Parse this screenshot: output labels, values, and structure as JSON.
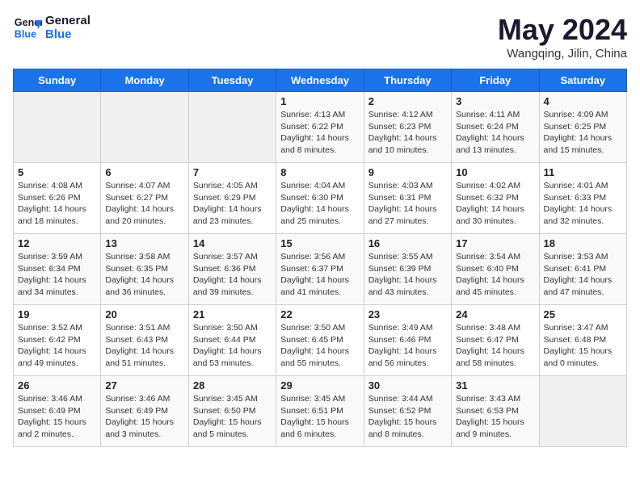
{
  "header": {
    "logo_line1": "General",
    "logo_line2": "Blue",
    "month_title": "May 2024",
    "location": "Wangqing, Jilin, China"
  },
  "days_of_week": [
    "Sunday",
    "Monday",
    "Tuesday",
    "Wednesday",
    "Thursday",
    "Friday",
    "Saturday"
  ],
  "weeks": [
    [
      {
        "day": "",
        "empty": true
      },
      {
        "day": "",
        "empty": true
      },
      {
        "day": "",
        "empty": true
      },
      {
        "day": "1",
        "sunrise": "4:13 AM",
        "sunset": "6:22 PM",
        "daylight": "14 hours and 8 minutes."
      },
      {
        "day": "2",
        "sunrise": "4:12 AM",
        "sunset": "6:23 PM",
        "daylight": "14 hours and 10 minutes."
      },
      {
        "day": "3",
        "sunrise": "4:11 AM",
        "sunset": "6:24 PM",
        "daylight": "14 hours and 13 minutes."
      },
      {
        "day": "4",
        "sunrise": "4:09 AM",
        "sunset": "6:25 PM",
        "daylight": "14 hours and 15 minutes."
      }
    ],
    [
      {
        "day": "5",
        "sunrise": "4:08 AM",
        "sunset": "6:26 PM",
        "daylight": "14 hours and 18 minutes."
      },
      {
        "day": "6",
        "sunrise": "4:07 AM",
        "sunset": "6:27 PM",
        "daylight": "14 hours and 20 minutes."
      },
      {
        "day": "7",
        "sunrise": "4:05 AM",
        "sunset": "6:29 PM",
        "daylight": "14 hours and 23 minutes."
      },
      {
        "day": "8",
        "sunrise": "4:04 AM",
        "sunset": "6:30 PM",
        "daylight": "14 hours and 25 minutes."
      },
      {
        "day": "9",
        "sunrise": "4:03 AM",
        "sunset": "6:31 PM",
        "daylight": "14 hours and 27 minutes."
      },
      {
        "day": "10",
        "sunrise": "4:02 AM",
        "sunset": "6:32 PM",
        "daylight": "14 hours and 30 minutes."
      },
      {
        "day": "11",
        "sunrise": "4:01 AM",
        "sunset": "6:33 PM",
        "daylight": "14 hours and 32 minutes."
      }
    ],
    [
      {
        "day": "12",
        "sunrise": "3:59 AM",
        "sunset": "6:34 PM",
        "daylight": "14 hours and 34 minutes."
      },
      {
        "day": "13",
        "sunrise": "3:58 AM",
        "sunset": "6:35 PM",
        "daylight": "14 hours and 36 minutes."
      },
      {
        "day": "14",
        "sunrise": "3:57 AM",
        "sunset": "6:36 PM",
        "daylight": "14 hours and 39 minutes."
      },
      {
        "day": "15",
        "sunrise": "3:56 AM",
        "sunset": "6:37 PM",
        "daylight": "14 hours and 41 minutes."
      },
      {
        "day": "16",
        "sunrise": "3:55 AM",
        "sunset": "6:39 PM",
        "daylight": "14 hours and 43 minutes."
      },
      {
        "day": "17",
        "sunrise": "3:54 AM",
        "sunset": "6:40 PM",
        "daylight": "14 hours and 45 minutes."
      },
      {
        "day": "18",
        "sunrise": "3:53 AM",
        "sunset": "6:41 PM",
        "daylight": "14 hours and 47 minutes."
      }
    ],
    [
      {
        "day": "19",
        "sunrise": "3:52 AM",
        "sunset": "6:42 PM",
        "daylight": "14 hours and 49 minutes."
      },
      {
        "day": "20",
        "sunrise": "3:51 AM",
        "sunset": "6:43 PM",
        "daylight": "14 hours and 51 minutes."
      },
      {
        "day": "21",
        "sunrise": "3:50 AM",
        "sunset": "6:44 PM",
        "daylight": "14 hours and 53 minutes."
      },
      {
        "day": "22",
        "sunrise": "3:50 AM",
        "sunset": "6:45 PM",
        "daylight": "14 hours and 55 minutes."
      },
      {
        "day": "23",
        "sunrise": "3:49 AM",
        "sunset": "6:46 PM",
        "daylight": "14 hours and 56 minutes."
      },
      {
        "day": "24",
        "sunrise": "3:48 AM",
        "sunset": "6:47 PM",
        "daylight": "14 hours and 58 minutes."
      },
      {
        "day": "25",
        "sunrise": "3:47 AM",
        "sunset": "6:48 PM",
        "daylight": "15 hours and 0 minutes."
      }
    ],
    [
      {
        "day": "26",
        "sunrise": "3:46 AM",
        "sunset": "6:49 PM",
        "daylight": "15 hours and 2 minutes."
      },
      {
        "day": "27",
        "sunrise": "3:46 AM",
        "sunset": "6:49 PM",
        "daylight": "15 hours and 3 minutes."
      },
      {
        "day": "28",
        "sunrise": "3:45 AM",
        "sunset": "6:50 PM",
        "daylight": "15 hours and 5 minutes."
      },
      {
        "day": "29",
        "sunrise": "3:45 AM",
        "sunset": "6:51 PM",
        "daylight": "15 hours and 6 minutes."
      },
      {
        "day": "30",
        "sunrise": "3:44 AM",
        "sunset": "6:52 PM",
        "daylight": "15 hours and 8 minutes."
      },
      {
        "day": "31",
        "sunrise": "3:43 AM",
        "sunset": "6:53 PM",
        "daylight": "15 hours and 9 minutes."
      },
      {
        "day": "",
        "empty": true
      }
    ]
  ]
}
